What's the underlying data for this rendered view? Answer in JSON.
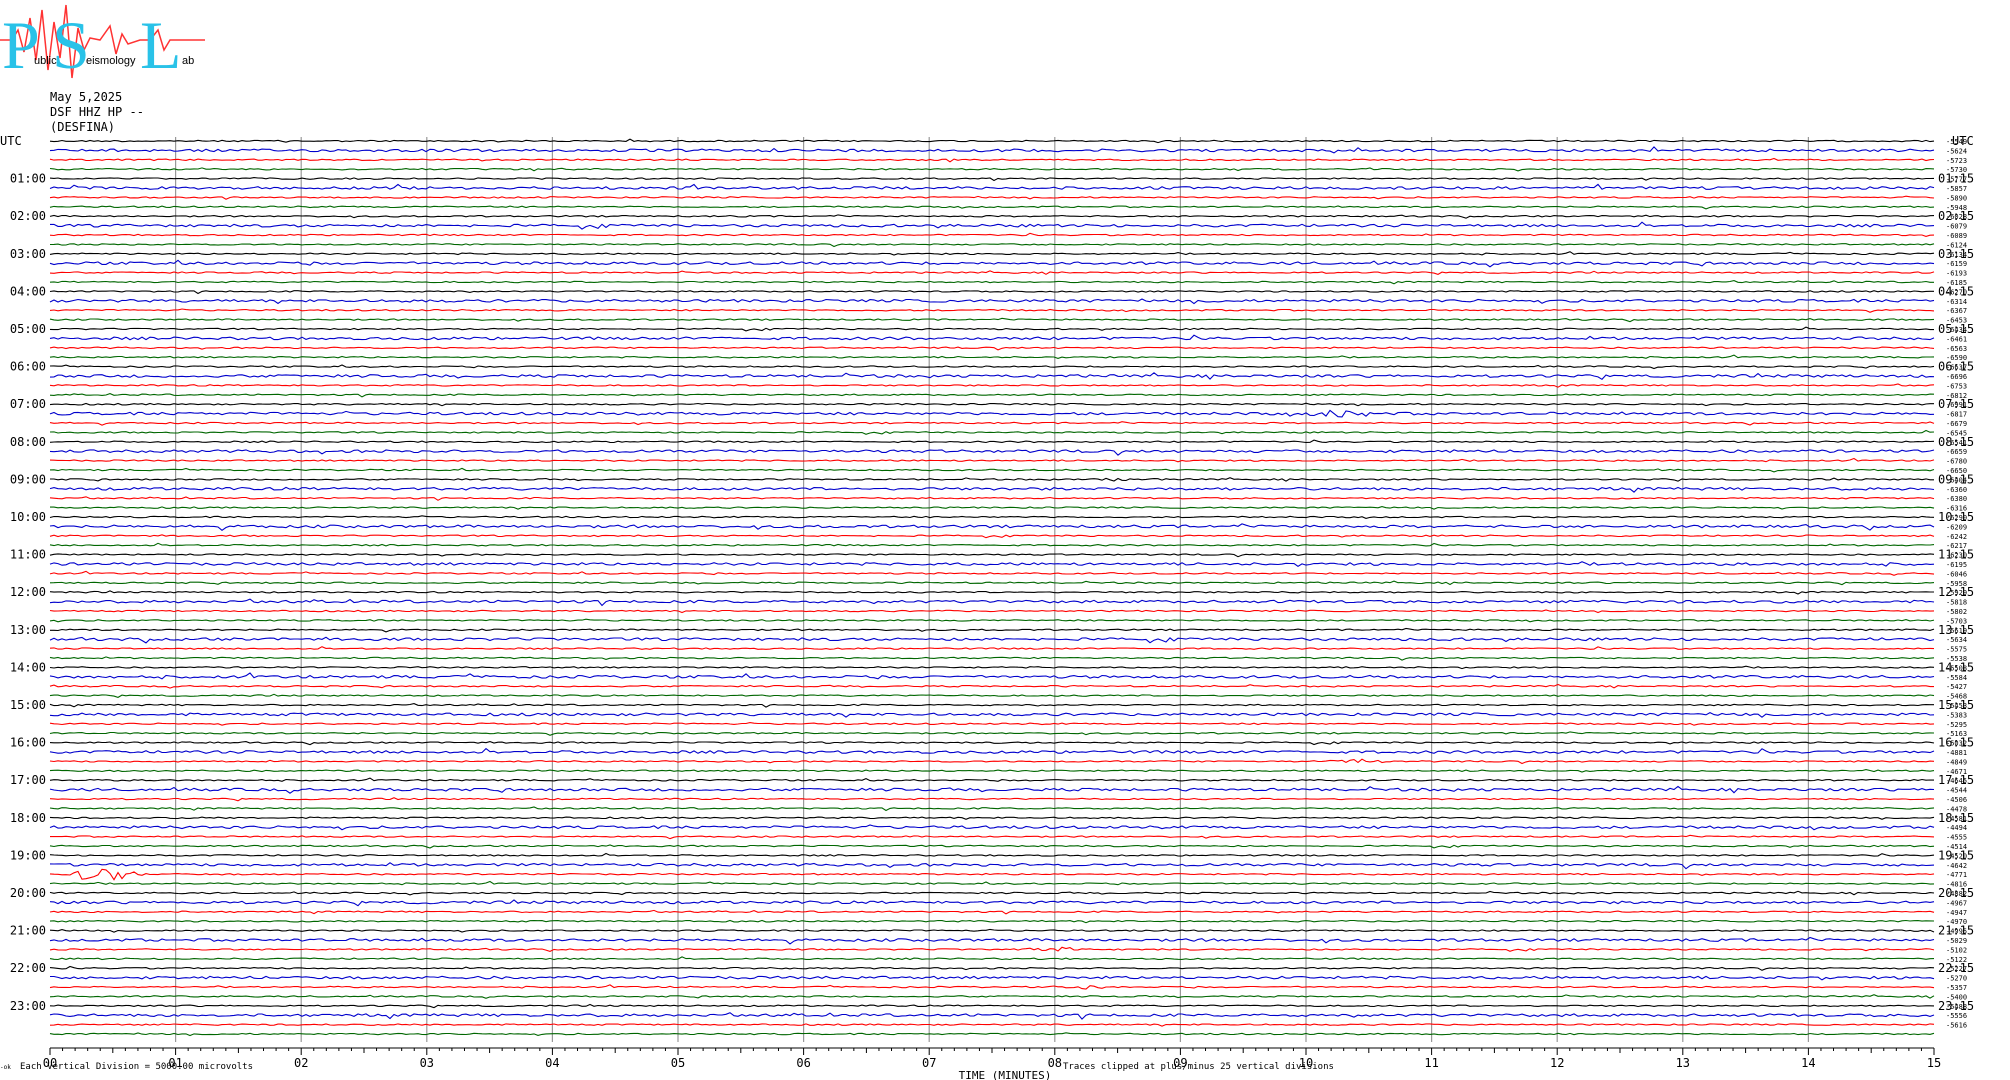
{
  "logo": {
    "letters": [
      "P",
      "S",
      "L"
    ],
    "small_text": [
      "ublic",
      "eismology",
      "ab"
    ],
    "text_color": "#29c2e8",
    "trace_color": "#ff3333"
  },
  "header": {
    "date": "May 5,2025",
    "station": "DSF HHZ HP --",
    "site": "(DESFINA)"
  },
  "footer": {
    "scale_note": "Each Vertical Division = 5000.00 microvolts",
    "clip_note": "Traces clipped at plus/minus 25 vertical divisions",
    "corner_mark": "-ok"
  },
  "chart_data": {
    "type": "line",
    "title": "",
    "xlabel": "TIME (MINUTES)",
    "ylabel": "",
    "xlim": [
      0,
      15
    ],
    "x_ticks": [
      "00",
      "01",
      "02",
      "03",
      "04",
      "05",
      "06",
      "07",
      "08",
      "09",
      "10",
      "11",
      "12",
      "13",
      "14",
      "15"
    ],
    "row_minutes": 15,
    "rows_per_day": 96,
    "left_axis_label": "UTC",
    "right_axis_label": "UTC",
    "left_hour_labels": [
      "01:00",
      "02:00",
      "03:00",
      "04:00",
      "05:00",
      "06:00",
      "07:00",
      "08:00",
      "09:00",
      "10:00",
      "11:00",
      "12:00",
      "13:00",
      "14:00",
      "15:00",
      "16:00",
      "17:00",
      "18:00",
      "19:00",
      "20:00",
      "21:00",
      "22:00",
      "23:00"
    ],
    "right_hour_labels": [
      "01:15",
      "02:15",
      "03:15",
      "04:15",
      "05:15",
      "06:15",
      "07:15",
      "08:15",
      "09:15",
      "10:15",
      "11:15",
      "12:15",
      "13:15",
      "14:15",
      "15:15",
      "16:15",
      "17:15",
      "18:15",
      "19:15",
      "20:15",
      "21:15",
      "22:15",
      "23:15"
    ],
    "trace_colors": [
      "#000000",
      "#0000cc",
      "#ff0000",
      "#006600"
    ],
    "offsets": [
      "-5549",
      "-5624",
      "-5723",
      "-5730",
      "-5777",
      "-5857",
      "-5890",
      "-5948",
      "-6028",
      "-6079",
      "-6089",
      "-6124",
      "-6134",
      "-6159",
      "-6193",
      "-6185",
      "-6270",
      "-6314",
      "-6367",
      "-6453",
      "-6434",
      "-6461",
      "-6563",
      "-6590",
      "-6637",
      "-6696",
      "-6753",
      "-6812",
      "-6991",
      "-6817",
      "-6679",
      "-6545",
      "-6541",
      "-6659",
      "-6780",
      "-6650",
      "-6404",
      "-6360",
      "-6380",
      "-6316",
      "-6290",
      "-6209",
      "-6242",
      "-6217",
      "-6230",
      "-6195",
      "-6046",
      "-5958",
      "-5929",
      "-5818",
      "-5802",
      "-5703",
      "-5619",
      "-5634",
      "-5575",
      "-5538",
      "-5508",
      "-5584",
      "-5427",
      "-5468",
      "-5453",
      "-5383",
      "-5295",
      "-5163",
      "-5032",
      "-4881",
      "-4849",
      "-4671",
      "-4645",
      "-4544",
      "-4506",
      "-4478",
      "-4581",
      "-4494",
      "-4555",
      "-4514",
      "-4520",
      "-4642",
      "-4771",
      "-4816",
      "-4882",
      "-4967",
      "-4947",
      "-4970",
      "-4995",
      "-5029",
      "-5102",
      "-5122",
      "-5227",
      "-5270",
      "-5357",
      "-5400",
      "-5488",
      "-5556",
      "-5616"
    ],
    "events": [
      {
        "row": 78,
        "minute": 0.42,
        "amplitude": 9
      },
      {
        "row": 29,
        "minute": 10.3,
        "amplitude": 4
      },
      {
        "row": 36,
        "minute": 8.5,
        "amplitude": 2
      },
      {
        "row": 86,
        "minute": 8.0,
        "amplitude": 2
      },
      {
        "row": 90,
        "minute": 8.2,
        "amplitude": 2
      },
      {
        "row": 66,
        "minute": 10.4,
        "amplitude": 2
      }
    ]
  }
}
